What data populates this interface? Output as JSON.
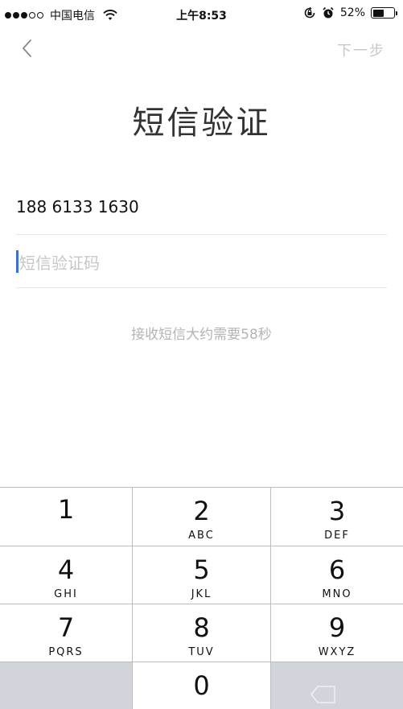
{
  "status_bar": {
    "carrier": "中国电信",
    "time": "上午8:53",
    "battery": "52%",
    "battery_level": 0.52,
    "signal_bars": 3,
    "signal_total": 5
  },
  "nav": {
    "next_label": "下一步"
  },
  "title": "短信验证",
  "phone_number": "188 6133 1630",
  "code_input": {
    "value": "",
    "placeholder": "短信验证码"
  },
  "hint": "接收短信大约需要58秒",
  "keypad": {
    "keys": [
      {
        "digit": "1",
        "letters": ""
      },
      {
        "digit": "2",
        "letters": "ABC"
      },
      {
        "digit": "3",
        "letters": "DEF"
      },
      {
        "digit": "4",
        "letters": "GHI"
      },
      {
        "digit": "5",
        "letters": "JKL"
      },
      {
        "digit": "6",
        "letters": "MNO"
      },
      {
        "digit": "7",
        "letters": "PQRS"
      },
      {
        "digit": "8",
        "letters": "TUV"
      },
      {
        "digit": "9",
        "letters": "WXYZ"
      },
      {
        "digit": "0",
        "letters": ""
      }
    ]
  },
  "colors": {
    "caret": "#3b6fe0",
    "key_gray": "#d1d5db"
  }
}
